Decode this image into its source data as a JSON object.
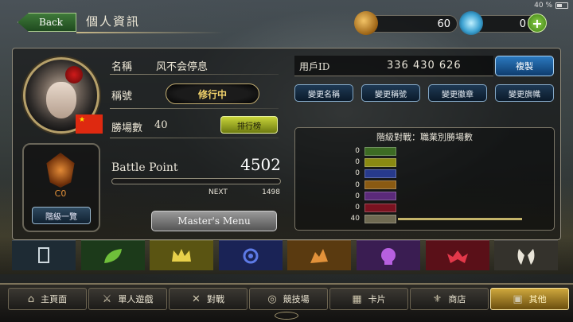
{
  "status_bar": {
    "battery": "40 %"
  },
  "header": {
    "back_label": "Back",
    "title": "個人資訊"
  },
  "currency": {
    "gold": "60",
    "crystals": "0",
    "add_label": "+"
  },
  "profile": {
    "name_label": "名稱",
    "name_value": "风不会停息",
    "title_label": "稱號",
    "title_value": "修行中",
    "wins_label": "勝場數",
    "wins_value": "40",
    "ranking_button": "排行榜",
    "flag_icon": "china-flag-icon"
  },
  "battle_point": {
    "label": "Battle Point",
    "value": "4502",
    "next_label": "NEXT",
    "next_value": "1498"
  },
  "masters_button": "Master's Menu",
  "rank": {
    "code": "C0",
    "list_button": "階級一覽"
  },
  "user_id": {
    "label": "用戶ID",
    "value": "336 430 626",
    "copy_button": "複製"
  },
  "change_buttons": [
    "變更名稱",
    "變更稱號",
    "變更徽章",
    "變更旗幟"
  ],
  "stats": {
    "title": "階級對戰：職業別勝場數",
    "rows": [
      {
        "count": "0",
        "color": "#3d6b24"
      },
      {
        "count": "0",
        "color": "#8a8a12"
      },
      {
        "count": "0",
        "color": "#273a8c"
      },
      {
        "count": "0",
        "color": "#8a5a12"
      },
      {
        "count": "0",
        "color": "#5b2a7a"
      },
      {
        "count": "0",
        "color": "#7a1220"
      },
      {
        "count": "40",
        "color": "#6f6a52",
        "fill": 1.0
      }
    ]
  },
  "class_tabs": [
    {
      "name": "card-icon",
      "bg": "#1e2b34"
    },
    {
      "name": "leaf-icon",
      "bg": "#1c3a1a"
    },
    {
      "name": "crown-icon",
      "bg": "#5a5412"
    },
    {
      "name": "star-emblem-icon",
      "bg": "#1a2356"
    },
    {
      "name": "dragon-icon",
      "bg": "#5a3a10"
    },
    {
      "name": "skull-icon",
      "bg": "#3a1d52"
    },
    {
      "name": "bat-icon",
      "bg": "#5a1018"
    },
    {
      "name": "wing-icon",
      "bg": "#34322c"
    }
  ],
  "nav": [
    {
      "label": "主頁面",
      "icon": "⌂"
    },
    {
      "label": "單人遊戲",
      "icon": "⚔"
    },
    {
      "label": "對戰",
      "icon": "✕"
    },
    {
      "label": "競技場",
      "icon": "◎"
    },
    {
      "label": "卡片",
      "icon": "▦"
    },
    {
      "label": "商店",
      "icon": "⚜"
    },
    {
      "label": "其他",
      "icon": "▣"
    }
  ]
}
